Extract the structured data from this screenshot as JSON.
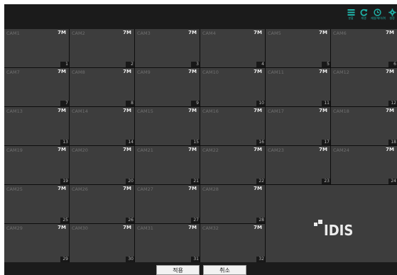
{
  "toolbar": {
    "items": [
      {
        "icon": "layout-icon",
        "label": "분할"
      },
      {
        "icon": "refresh-icon",
        "label": "재생"
      },
      {
        "icon": "clock-icon",
        "label": "재생/제어/위"
      },
      {
        "icon": "gear-icon",
        "label": "설정"
      }
    ],
    "accent_color": "#1fb3a8"
  },
  "cameras": [
    {
      "name": "CAM1",
      "res": "7M",
      "num": "1"
    },
    {
      "name": "CAM2",
      "res": "7M",
      "num": "2"
    },
    {
      "name": "CAM3",
      "res": "7M",
      "num": "3"
    },
    {
      "name": "CAM4",
      "res": "7M",
      "num": "4"
    },
    {
      "name": "CAM5",
      "res": "7M",
      "num": "5"
    },
    {
      "name": "CAM6",
      "res": "7M",
      "num": "6"
    },
    {
      "name": "CAM7",
      "res": "7M",
      "num": "7"
    },
    {
      "name": "CAM8",
      "res": "7M",
      "num": "8"
    },
    {
      "name": "CAM9",
      "res": "7M",
      "num": "9"
    },
    {
      "name": "CAM10",
      "res": "7M",
      "num": "10"
    },
    {
      "name": "CAM11",
      "res": "7M",
      "num": "11"
    },
    {
      "name": "CAM12",
      "res": "7M",
      "num": "12"
    },
    {
      "name": "CAM13",
      "res": "7M",
      "num": "13"
    },
    {
      "name": "CAM14",
      "res": "7M",
      "num": "14"
    },
    {
      "name": "CAM15",
      "res": "7M",
      "num": "15"
    },
    {
      "name": "CAM16",
      "res": "7M",
      "num": "16"
    },
    {
      "name": "CAM17",
      "res": "7M",
      "num": "17"
    },
    {
      "name": "CAM18",
      "res": "7M",
      "num": "18"
    },
    {
      "name": "CAM19",
      "res": "7M",
      "num": "19"
    },
    {
      "name": "CAM20",
      "res": "7M",
      "num": "20"
    },
    {
      "name": "CAM21",
      "res": "7M",
      "num": "21"
    },
    {
      "name": "CAM22",
      "res": "7M",
      "num": "22"
    },
    {
      "name": "CAM23",
      "res": "7M",
      "num": "23"
    },
    {
      "name": "CAM24",
      "res": "7M",
      "num": "24"
    },
    {
      "name": "CAM25",
      "res": "7M",
      "num": "25"
    },
    {
      "name": "CAM26",
      "res": "7M",
      "num": "26"
    },
    {
      "name": "CAM27",
      "res": "7M",
      "num": "27"
    },
    {
      "name": "CAM28",
      "res": "7M",
      "num": "28"
    },
    {
      "name": "CAM29",
      "res": "7M",
      "num": "29"
    },
    {
      "name": "CAM30",
      "res": "7M",
      "num": "30"
    },
    {
      "name": "CAM31",
      "res": "7M",
      "num": "31"
    },
    {
      "name": "CAM32",
      "res": "7M",
      "num": "32"
    }
  ],
  "logo": {
    "text": "IDIS"
  },
  "footer": {
    "apply_label": "적용",
    "cancel_label": "취소"
  }
}
